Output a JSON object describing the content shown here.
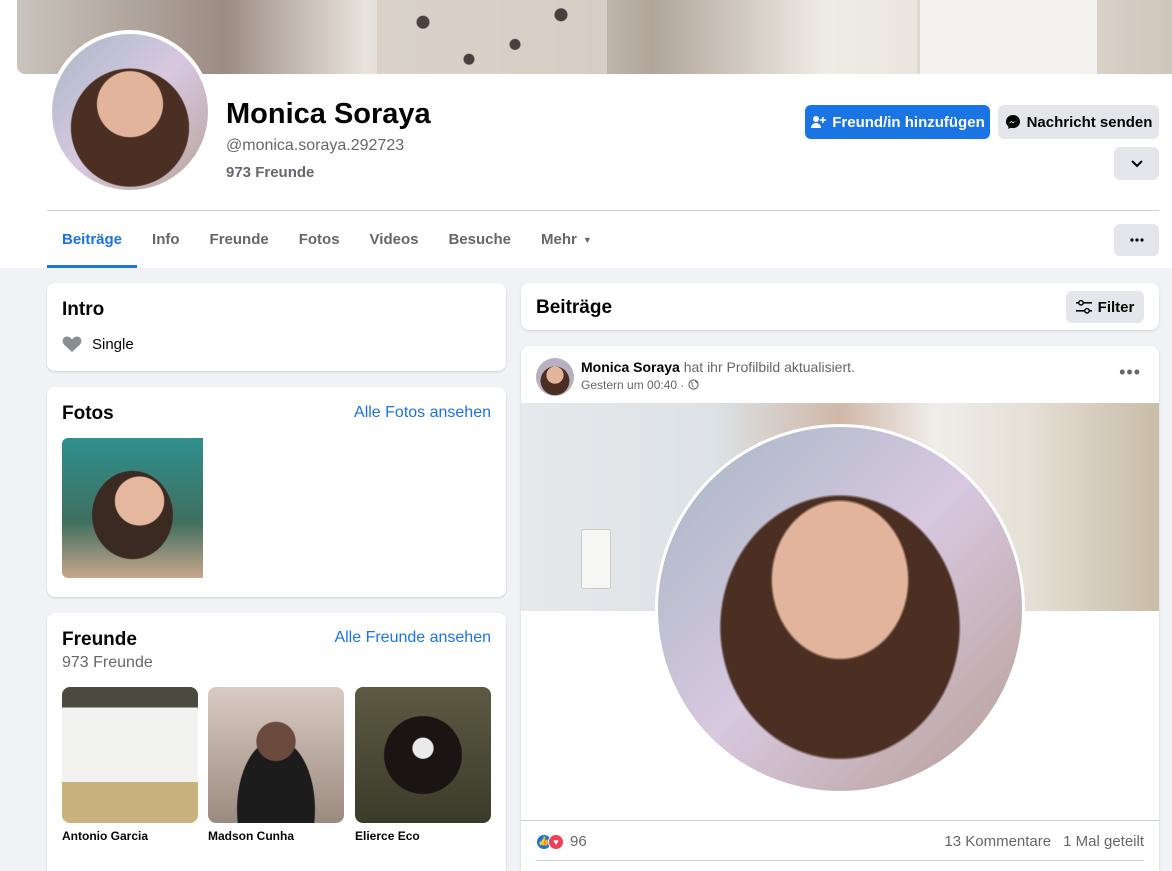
{
  "profile": {
    "name": "Monica Soraya",
    "handle": "@monica.soraya.292723",
    "friends_count": "973 Freunde"
  },
  "actions": {
    "add_friend": "Freund/in hinzufügen",
    "message": "Nachricht senden"
  },
  "tabs": [
    {
      "label": "Beiträge",
      "active": true
    },
    {
      "label": "Info"
    },
    {
      "label": "Freunde"
    },
    {
      "label": "Fotos"
    },
    {
      "label": "Videos"
    },
    {
      "label": "Besuche"
    },
    {
      "label": "Mehr"
    }
  ],
  "intro": {
    "title": "Intro",
    "relationship": "Single"
  },
  "photos": {
    "title": "Fotos",
    "see_all": "Alle Fotos ansehen"
  },
  "friends": {
    "title": "Freunde",
    "count": "973 Freunde",
    "see_all": "Alle Freunde ansehen",
    "items": [
      {
        "name": "Antonio Garcia"
      },
      {
        "name": "Madson Cunha"
      },
      {
        "name": "Elierce Eco"
      }
    ]
  },
  "posts_header": {
    "title": "Beiträge",
    "filter": "Filter"
  },
  "post": {
    "author": "Monica Soraya",
    "action": "hat ihr Profilbild aktualisiert.",
    "time": "Gestern um 00:40 ·",
    "reactions_count": "96",
    "comments": "13 Kommentare",
    "shares": "1 Mal geteilt"
  },
  "colors": {
    "accent": "#1b74e4",
    "background": "#f0f2f5",
    "secondary_text": "#65676b"
  }
}
